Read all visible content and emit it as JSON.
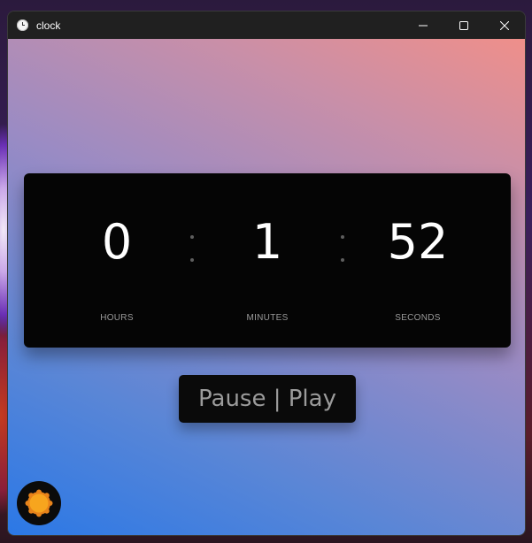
{
  "window": {
    "title": "clock",
    "app_icon": "clock-icon",
    "controls": {
      "minimize": "minimize-icon",
      "maximize": "maximize-icon",
      "close": "close-icon"
    }
  },
  "clock": {
    "hours": {
      "value": "0",
      "label": "HOURS"
    },
    "minutes": {
      "value": "1",
      "label": "MINUTES"
    },
    "seconds": {
      "value": "52",
      "label": "SECONDS"
    }
  },
  "controls": {
    "pause_play_label": "Pause | Play",
    "theme_toggle_icon": "sun-icon"
  },
  "colors": {
    "background_gradient_start": "#2b78e6",
    "background_gradient_end": "#ef8f8a",
    "card": "#050505",
    "digits": "#ffffff",
    "labels": "#9a9a9a",
    "button_text": "#9b9b9b",
    "sun": "#f7a51e"
  }
}
